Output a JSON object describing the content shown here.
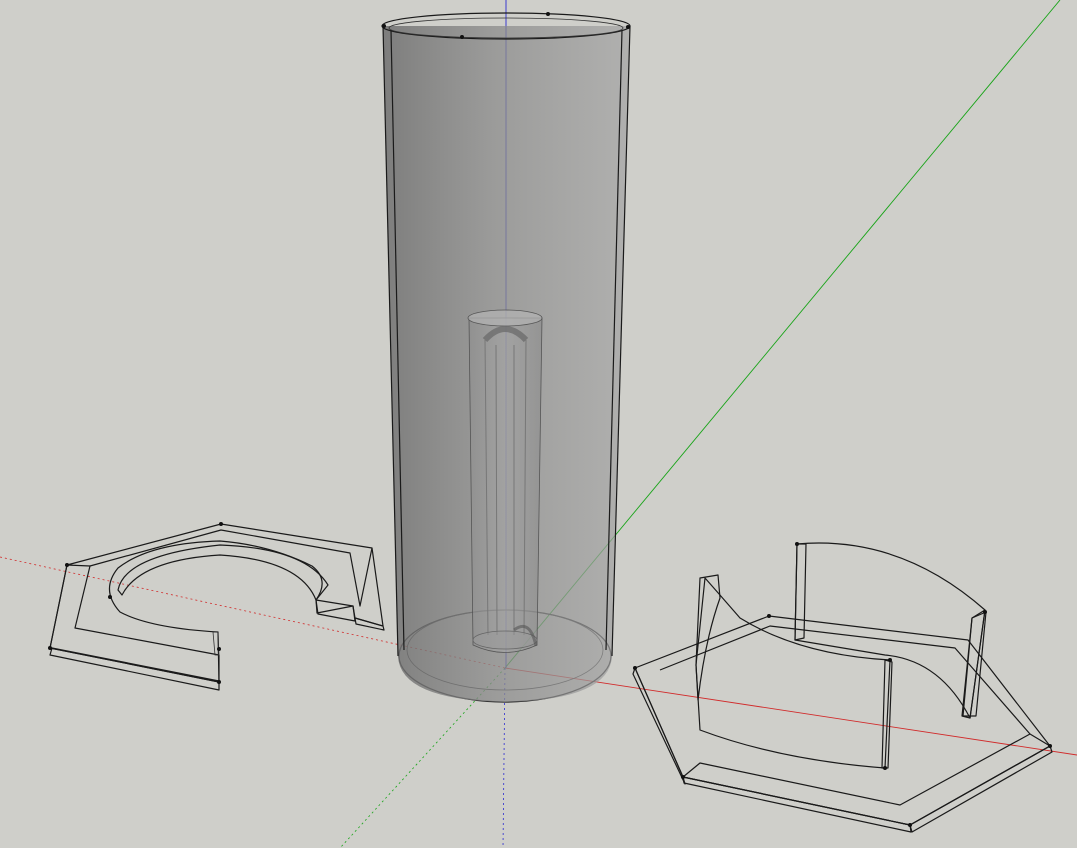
{
  "viewport": {
    "background": "#cfcfca",
    "axes": {
      "red": "#d12b2b",
      "green": "#18a418",
      "blue": "#2b2bd1"
    }
  },
  "model": {
    "objects": [
      {
        "name": "transparent-outer-cylinder"
      },
      {
        "name": "inner-tube"
      },
      {
        "name": "hex-ring-base-left"
      },
      {
        "name": "hex-ring-base-with-walls-right"
      }
    ]
  }
}
